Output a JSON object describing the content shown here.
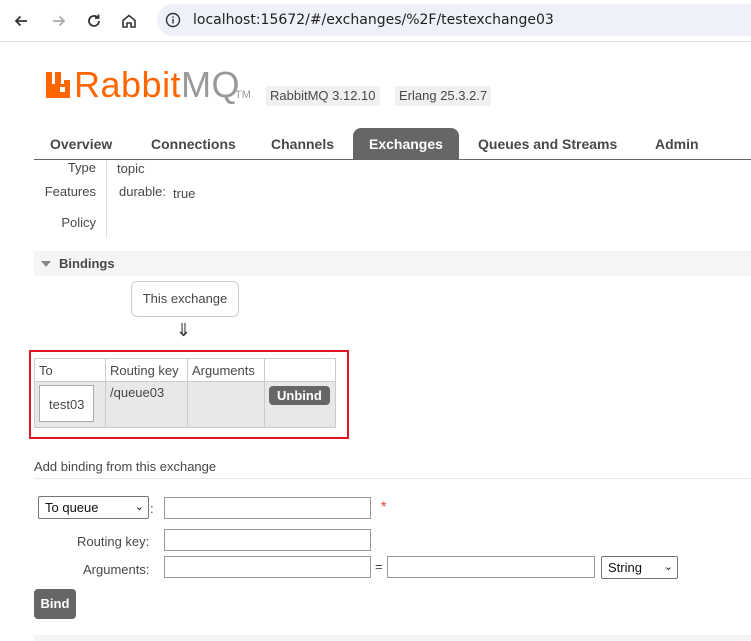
{
  "browser": {
    "url": "localhost:15672/#/exchanges/%2F/testexchange03"
  },
  "header": {
    "logo_rabbit": "Rabbit",
    "logo_mq": "MQ",
    "logo_tm": "TM",
    "version": "RabbitMQ 3.12.10",
    "erlang": "Erlang 25.3.2.7"
  },
  "tabs": [
    {
      "label": "Overview"
    },
    {
      "label": "Connections"
    },
    {
      "label": "Channels"
    },
    {
      "label": "Exchanges"
    },
    {
      "label": "Queues and Streams"
    },
    {
      "label": "Admin"
    }
  ],
  "details": {
    "type_label": "Type",
    "type_value": "topic",
    "features_label": "Features",
    "durable_key": "durable:",
    "durable_value": "true",
    "policy_label": "Policy"
  },
  "bindings": {
    "section_title": "Bindings",
    "this_exchange": "This exchange",
    "arrow": "⇓",
    "columns": [
      "To",
      "Routing key",
      "Arguments",
      ""
    ],
    "rows": [
      {
        "to": "test03",
        "routing_key": "/queue03",
        "arguments": "",
        "action": "Unbind"
      }
    ]
  },
  "add_binding": {
    "title": "Add binding from this exchange",
    "dest_type": "To queue",
    "colon": ":",
    "required_mark": "*",
    "routing_key_label": "Routing key:",
    "arguments_label": "Arguments:",
    "equals": "=",
    "arg_type": "String",
    "bind_label": "Bind"
  },
  "colors": {
    "brand_orange": "#ff6600",
    "tab_active_bg": "#666666",
    "highlight_red": "#e0141e"
  }
}
